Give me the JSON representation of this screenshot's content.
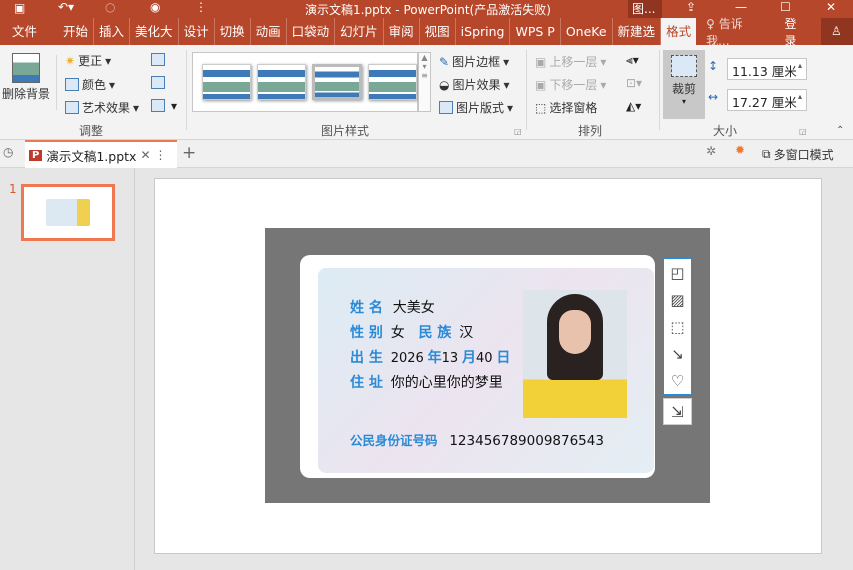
{
  "titlebar": {
    "title": "演示文稿1.pptx - PowerPoint(产品激活失败)",
    "context_tab": "图...",
    "icons": [
      "save-icon",
      "undo-icon",
      "redo-icon",
      "present-icon",
      "customize-icon",
      "ribbon-display-icon",
      "minimize-icon",
      "maximize-icon",
      "close-icon"
    ]
  },
  "tabs": [
    "文件",
    "开始",
    "插入",
    "美化大",
    "设计",
    "切换",
    "动画",
    "口袋动",
    "幻灯片",
    "审阅",
    "视图",
    "iSpring",
    "WPS P",
    "OneKe",
    "新建选",
    "格式"
  ],
  "active_tab": "格式",
  "tell_me": "告诉我...",
  "login": "登录",
  "share": "共享",
  "ribbon": {
    "remove_bg": "删除背景",
    "adjust": {
      "corrections": "更正",
      "color": "颜色",
      "artistic": "艺术效果",
      "label": "调整"
    },
    "styles": {
      "label": "图片样式",
      "border": "图片边框",
      "effects": "图片效果",
      "layout": "图片版式"
    },
    "arrange": {
      "label": "排列",
      "bring_forward": "上移一层",
      "send_backward": "下移一层",
      "selection_pane": "选择窗格"
    },
    "size": {
      "label": "大小",
      "crop": "裁剪",
      "height": "11.13 厘米",
      "width": "17.27 厘米"
    }
  },
  "doc_tab": {
    "name": "演示文稿1.pptx",
    "multiwindow": "多窗口模式"
  },
  "slides": [
    {
      "number": "1"
    }
  ],
  "card": {
    "name_label": "姓 名",
    "name": "大美女",
    "sex_label": "性 别",
    "sex": "女",
    "ethnic_label": "民 族",
    "ethnic": "汉",
    "birth_label": "出 生",
    "year": "2026",
    "year_unit": "年",
    "month": "13",
    "month_unit": "月",
    "day": "40",
    "day_unit": "日",
    "addr_label": "住 址",
    "addr": "你的心里你的梦里",
    "id_label": "公民身份证号码",
    "id": "12345678900987654 3"
  },
  "colors": {
    "brand": "#b7472a",
    "accent_blue": "#2a8ad6",
    "thumb_border": "#f07850"
  }
}
